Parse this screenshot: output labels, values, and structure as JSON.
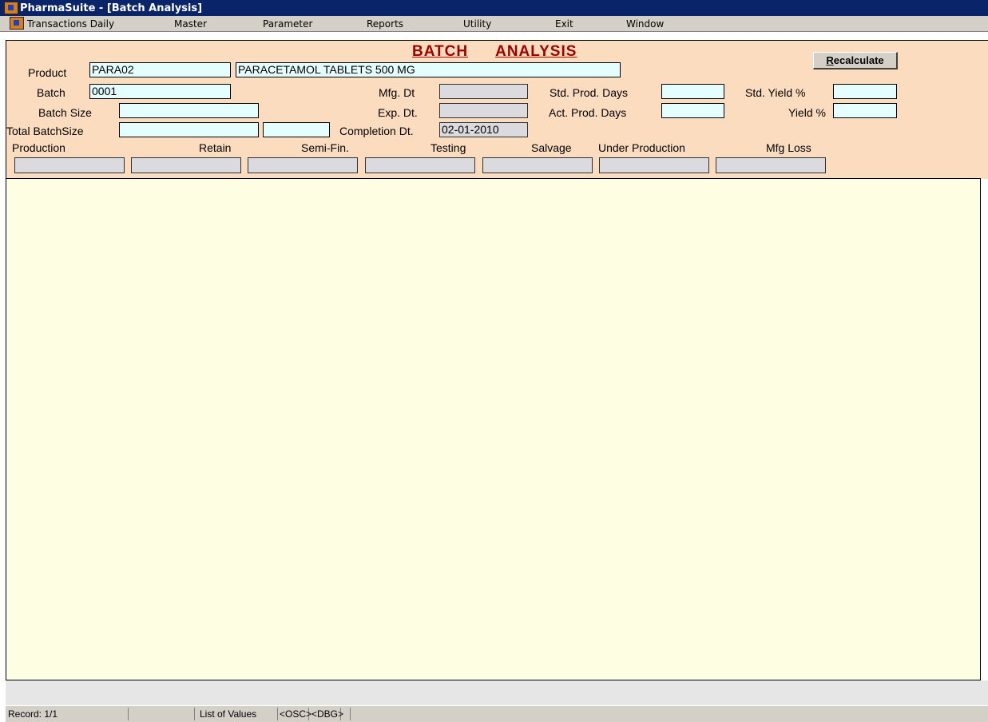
{
  "window": {
    "title": "PharmaSuite - [Batch Analysis]"
  },
  "menu": [
    "Transactions Daily",
    "Master",
    "Parameter",
    "Reports",
    "Utility",
    "Exit",
    "Window"
  ],
  "form": {
    "title_left": "BATCH",
    "title_right": "ANALYSIS",
    "recalculate_first": "R",
    "recalculate_rest": "ecalculate",
    "labels": {
      "product": "Product",
      "batch": "Batch",
      "batch_size": "Batch Size",
      "total_batch_size": "Total BatchSize",
      "mfg_dt": "Mfg. Dt",
      "exp_dt": "Exp. Dt.",
      "completion_dt": "Completion Dt.",
      "std_prod_days": "Std. Prod. Days",
      "act_prod_days": "Act. Prod. Days",
      "std_yield": "Std. Yield %",
      "yield": "Yield %"
    },
    "values": {
      "product_code": "PARA02",
      "product_name": "PARACETAMOL TABLETS 500 MG",
      "batch": "0001",
      "batch_size": "",
      "total_batch_size": "",
      "total_batch_size_unit": "",
      "mfg_dt": "",
      "exp_dt": "",
      "completion_dt": "02-01-2010",
      "std_prod_days": "",
      "act_prod_days": "",
      "std_yield": "",
      "yield": ""
    },
    "summary_headers": {
      "production": "Production",
      "retain": "Retain",
      "semi_fin": "Semi-Fin.",
      "testing": "Testing",
      "salvage": "Salvage",
      "under_production": "Under Production",
      "mfg_loss": "Mfg Loss"
    }
  },
  "status": {
    "record": "Record: 1/1",
    "list_of_values": "List of Values",
    "osc": "<OSC>",
    "dbg": "<DBG>"
  }
}
